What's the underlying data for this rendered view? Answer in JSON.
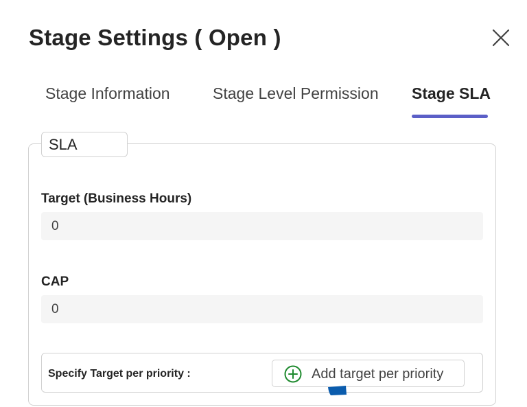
{
  "dialog": {
    "title": "Stage Settings ( Open )",
    "close_icon": "close-icon"
  },
  "tabs": [
    {
      "label": "Stage Information",
      "active": false
    },
    {
      "label": "Stage Level Permission",
      "active": false
    },
    {
      "label": "Stage SLA",
      "active": true
    }
  ],
  "colors": {
    "accent": "#5b5fc7",
    "add_icon": "#1e8a2e",
    "input_bg": "#f5f5f5",
    "border": "#d1d1d1",
    "cursor_mark": "#0b5cad"
  },
  "sla": {
    "legend": "SLA",
    "target_label": "Target (Business Hours)",
    "target_value": "0",
    "cap_label": "CAP",
    "cap_value": "0",
    "priority_label": "Specify Target per priority :",
    "add_button_label": "Add target per priority",
    "add_button_icon": "plus-circle-icon"
  }
}
